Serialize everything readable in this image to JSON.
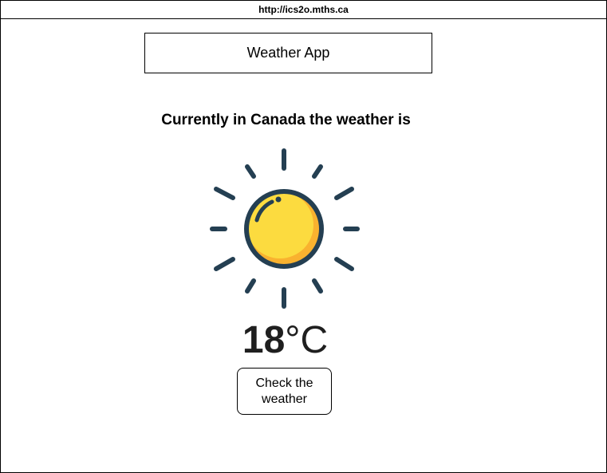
{
  "browser": {
    "url": "http://ics2o.mths.ca"
  },
  "header": {
    "title": "Weather App"
  },
  "main": {
    "subtitle": "Currently in Canada the weather is",
    "weather_icon": "sun-icon",
    "temperature": {
      "value": "18",
      "unit": "°C"
    },
    "check_button_label": "Check the\nweather"
  },
  "colors": {
    "sun_fill": "#FCDB3F",
    "sun_shadow": "#F9B22F",
    "sun_outline": "#243F52"
  }
}
